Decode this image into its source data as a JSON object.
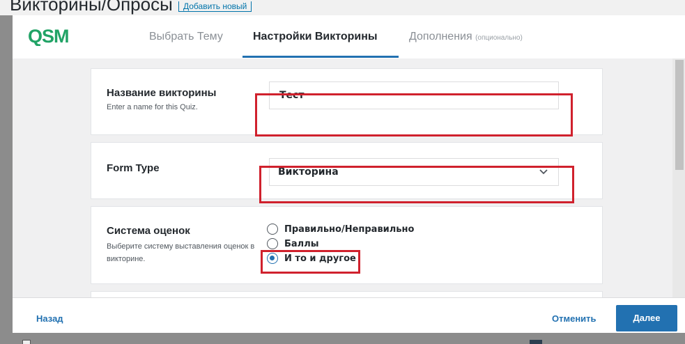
{
  "background": {
    "page_title": "Викторины/Опросы",
    "add_new_label": "Добавить новый"
  },
  "header": {
    "logo_text": "QSM",
    "tabs": [
      {
        "label": "Выбрать Тему",
        "active": false
      },
      {
        "label": "Настройки Викторины",
        "active": true
      },
      {
        "label": "Дополнения",
        "suffix": "(опционально)",
        "active": false
      }
    ]
  },
  "form": {
    "quiz_name": {
      "label": "Название викторины",
      "description": "Enter a name for this Quiz.",
      "value": "Тест"
    },
    "form_type": {
      "label": "Form Type",
      "selected": "Викторина"
    },
    "grading": {
      "label": "Система оценок",
      "description": "Выберите систему выставления оценок в викторине.",
      "options": [
        {
          "label": "Правильно/Неправильно",
          "checked": false
        },
        {
          "label": "Баллы",
          "checked": false
        },
        {
          "label": "И то и другое",
          "checked": true
        }
      ]
    }
  },
  "footer": {
    "back_label": "Назад",
    "cancel_label": "Отменить",
    "next_label": "Далее"
  },
  "colors": {
    "accent": "#2271b1",
    "highlight": "#d0212d",
    "logo_green": "#21a366"
  }
}
